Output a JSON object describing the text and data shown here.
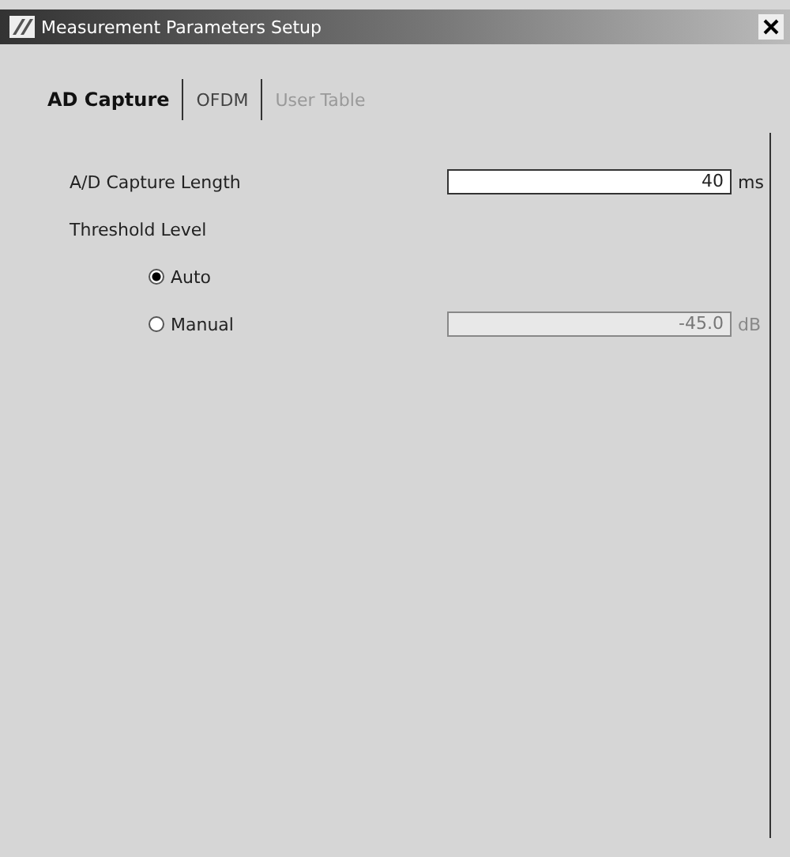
{
  "window": {
    "title": "Measurement Parameters Setup"
  },
  "tabs": [
    {
      "label": "AD Capture",
      "selected": true,
      "disabled": false
    },
    {
      "label": "OFDM",
      "selected": false,
      "disabled": false
    },
    {
      "label": "User Table",
      "selected": false,
      "disabled": true
    }
  ],
  "capture_length": {
    "label": "A/D Capture Length",
    "value": "40",
    "unit": "ms"
  },
  "threshold": {
    "label": "Threshold Level",
    "options": [
      {
        "label": "Auto",
        "selected": true
      },
      {
        "label": "Manual",
        "selected": false
      }
    ],
    "manual_field": {
      "value": "-45.0",
      "unit": "dB",
      "disabled": true
    }
  }
}
